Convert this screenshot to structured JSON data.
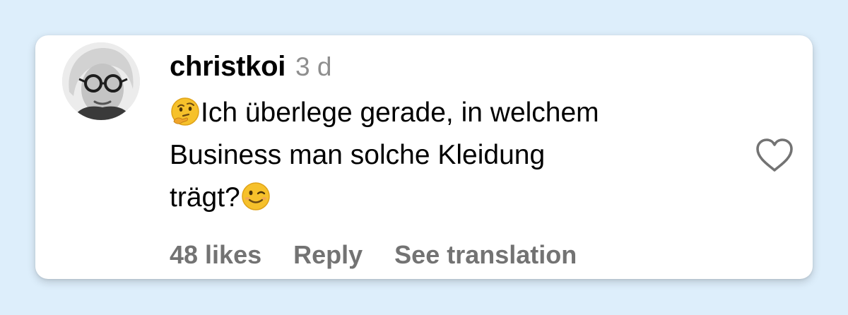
{
  "comment": {
    "author": {
      "username": "christkoi",
      "avatar_icon": "user-avatar-photo"
    },
    "timestamp": "3 d",
    "lines": [
      "Ich überlege gerade, in welchem",
      "Business man solche Kleidung",
      "trägt?"
    ],
    "emojis": {
      "leading": "thinking-face-emoji",
      "trailing": "winking-face-emoji"
    },
    "like_icon": "heart-outline-icon",
    "likes_label": "48 likes",
    "reply_label": "Reply",
    "translate_label": "See translation"
  },
  "colors": {
    "background": "#ddeefb",
    "card": "#ffffff",
    "username": "#000000",
    "muted": "#8e8e8e",
    "action_text": "#737373"
  }
}
